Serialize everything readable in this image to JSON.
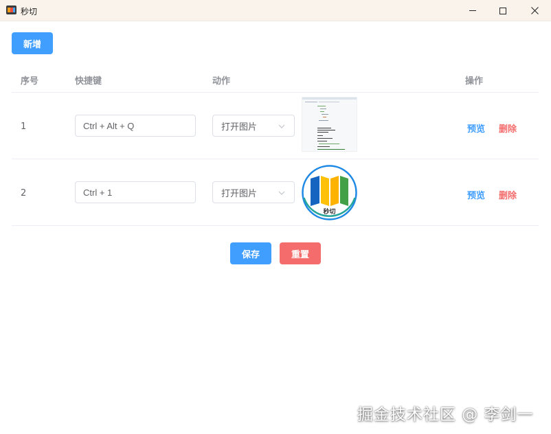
{
  "window": {
    "title": "秒切"
  },
  "toolbar": {
    "add_label": "新增"
  },
  "table": {
    "headers": {
      "index": "序号",
      "shortcut": "快捷键",
      "action": "动作",
      "operation": "操作"
    },
    "rows": [
      {
        "index": "1",
        "shortcut": "Ctrl + Alt + Q",
        "action": "打开图片",
        "preview_label": "预览",
        "delete_label": "删除"
      },
      {
        "index": "2",
        "shortcut": "Ctrl + 1",
        "action": "打开图片",
        "preview_label": "预览",
        "delete_label": "删除",
        "thumbnail_logo_text": "秒切"
      }
    ]
  },
  "footer": {
    "save_label": "保存",
    "reset_label": "重置"
  },
  "watermark": "掘金技术社区 @ 李剑一",
  "colors": {
    "primary": "#409eff",
    "danger": "#f56c6c",
    "header_text": "#909399",
    "border": "#dcdfe6",
    "titlebar": "#f9f3ec"
  }
}
